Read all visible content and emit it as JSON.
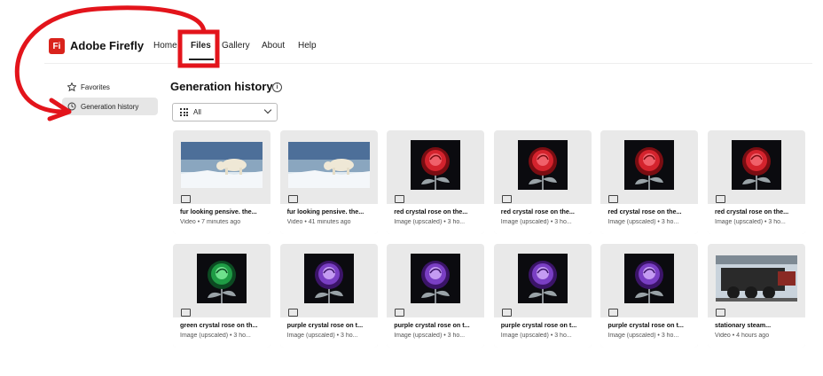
{
  "app": {
    "brand": "Adobe Firefly",
    "logo_text": "Fi",
    "brand_color": "#d9231c"
  },
  "nav": {
    "items": [
      {
        "label": "Home"
      },
      {
        "label": "Files"
      },
      {
        "label": "Gallery"
      },
      {
        "label": "About"
      },
      {
        "label": "Help"
      }
    ],
    "active": "Files"
  },
  "sidebar": {
    "items": [
      {
        "label": "Favorites",
        "icon": "star-icon"
      },
      {
        "label": "Generation history",
        "icon": "clock-icon"
      }
    ],
    "active": "Generation history"
  },
  "main": {
    "title": "Generation history",
    "filter": {
      "value": "All"
    }
  },
  "cards": [
    {
      "title": "fur looking pensive. the...",
      "meta": "Video • 7 minutes ago",
      "type": "video",
      "thumb": "polar-bear"
    },
    {
      "title": "fur looking pensive. the...",
      "meta": "Video • 41 minutes ago",
      "type": "video",
      "thumb": "polar-bear"
    },
    {
      "title": "red crystal rose on the...",
      "meta": "Image (upscaled) • 3 ho...",
      "type": "image",
      "thumb": "red-rose"
    },
    {
      "title": "red crystal rose on the...",
      "meta": "Image (upscaled) • 3 ho...",
      "type": "image",
      "thumb": "red-rose"
    },
    {
      "title": "red crystal rose on the...",
      "meta": "Image (upscaled) • 3 ho...",
      "type": "image",
      "thumb": "red-rose"
    },
    {
      "title": "red crystal rose on the...",
      "meta": "Image (upscaled) • 3 ho...",
      "type": "image",
      "thumb": "red-rose"
    },
    {
      "title": "green crystal rose on th...",
      "meta": "Image (upscaled) • 3 ho...",
      "type": "image",
      "thumb": "green-rose"
    },
    {
      "title": "purple crystal rose on t...",
      "meta": "Image (upscaled) • 3 ho...",
      "type": "image",
      "thumb": "purple-rose"
    },
    {
      "title": "purple crystal rose on t...",
      "meta": "Image (upscaled) • 3 ho...",
      "type": "image",
      "thumb": "purple-rose"
    },
    {
      "title": "purple crystal rose on t...",
      "meta": "Image (upscaled) • 3 ho...",
      "type": "image",
      "thumb": "purple-rose"
    },
    {
      "title": "purple crystal rose on t...",
      "meta": "Image (upscaled) • 3 ho...",
      "type": "image",
      "thumb": "purple-rose"
    },
    {
      "title": "stationary steam...",
      "meta": "Video • 4 hours ago",
      "type": "video",
      "thumb": "steam-train"
    }
  ],
  "annotation": {
    "color": "#e3141b"
  }
}
